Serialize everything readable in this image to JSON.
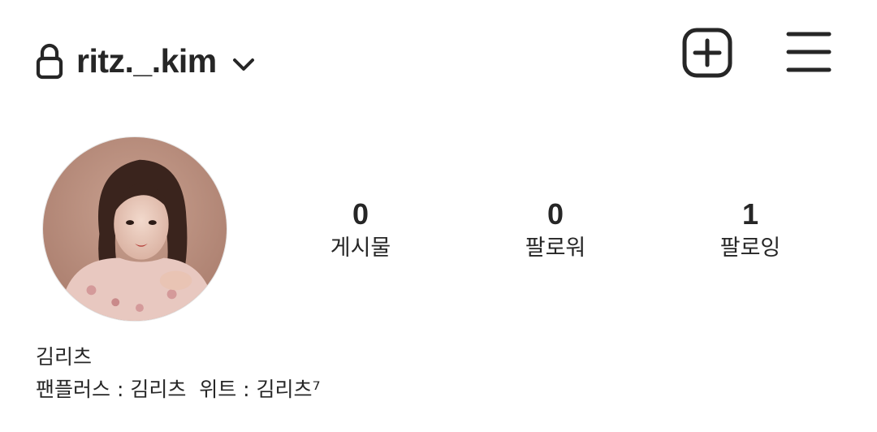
{
  "header": {
    "username": "ritz._.kim",
    "icons": {
      "lock": "lock-icon",
      "chevron": "chevron-down-icon",
      "new_post": "plus-square-icon",
      "menu": "hamburger-menu-icon"
    }
  },
  "profile": {
    "avatar": "profile-photo",
    "stats": [
      {
        "count": "0",
        "label": "게시물"
      },
      {
        "count": "0",
        "label": "팔로워"
      },
      {
        "count": "1",
        "label": "팔로잉"
      }
    ],
    "display_name": "김리츠",
    "bio": "팬플러스 : 김리츠  위트 : 김리츠⁷"
  },
  "colors": {
    "text": "#262626",
    "background": "#ffffff"
  }
}
